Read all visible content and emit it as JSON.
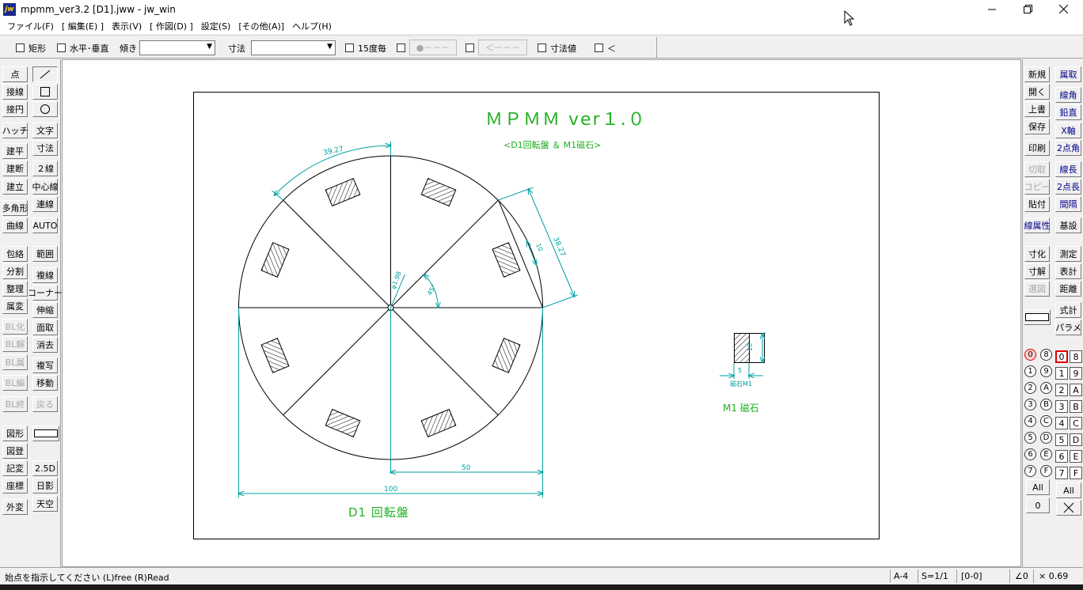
{
  "window": {
    "title": "mpmm_ver3.2 [D1].jww - jw_win",
    "logo_text": "jw",
    "minimize_icon": "minimize-icon",
    "restore_icon": "restore-icon",
    "close_icon": "close-icon"
  },
  "menu": [
    "ファイル(F)",
    "[ 編集(E) ]",
    "表示(V)",
    "[ 作図(D) ]",
    "設定(S)",
    "[その他(A)]",
    "ヘルプ(H)"
  ],
  "options": {
    "rect": "矩形",
    "hv": "水平･垂直",
    "tilt": "傾き",
    "tilt_value": "",
    "dim": "寸法",
    "dim_value": "",
    "deg15": "15度毎",
    "btn_a": "●－－－",
    "btn_b": "＜－－－",
    "dimval": "寸法値",
    "lt": "＜"
  },
  "left_tools": {
    "col1": [
      "点",
      "接線",
      "接円",
      "ハッチ",
      "建平",
      "建断",
      "建立",
      "多角形",
      "曲線",
      "包絡",
      "分割",
      "整理",
      "属変",
      "BL化",
      "BL解",
      "BL属",
      "BL編",
      "BL終",
      "図形",
      "図登",
      "記変",
      "座標",
      "外変"
    ],
    "col2": [
      "文字",
      "寸法",
      "２線",
      "中心線",
      "連線",
      "AUTO",
      "範囲",
      "複線",
      "コーナー",
      "伸縮",
      "面取",
      "消去",
      "複写",
      "移動",
      "戻る",
      "2.5D",
      "日影",
      "天空"
    ]
  },
  "right_tools": {
    "col1": [
      "新規",
      "開く",
      "上書",
      "保存",
      "印刷",
      "切取",
      "コピー",
      "貼付",
      "線属性",
      "寸化",
      "寸解",
      "選図"
    ],
    "col2": [
      "属取",
      "線角",
      "鉛直",
      "X軸",
      "2点角",
      "線長",
      "2点長",
      "間隔",
      "基設",
      "測定",
      "表計",
      "距離",
      "式計",
      "パラメ"
    ],
    "layer_groups": [
      "0",
      "1",
      "2",
      "3",
      "4",
      "5",
      "6",
      "7",
      "8",
      "9",
      "A",
      "B",
      "C",
      "D",
      "E",
      "F"
    ],
    "layers": [
      "0",
      "1",
      "2",
      "3",
      "4",
      "5",
      "6",
      "7",
      "8",
      "9",
      "A",
      "B",
      "C",
      "D",
      "E",
      "F"
    ],
    "all_label": "All",
    "zero_label": "0"
  },
  "drawing": {
    "title": "ＭＰＭＭ ver１.０",
    "subtitle": "<D1回転盤 ＆ M1磁石>",
    "d1_label": "D1 回転盤",
    "m1_label": "M1 磁石",
    "magnet_small_label": "磁石M1",
    "dim_100": "100",
    "dim_50": "50",
    "dim_arc": "39.27",
    "dim_chord": "38.27",
    "dim_10_a": "10",
    "dim_10_b": "10",
    "dim_5": "5",
    "dim_phi": "φ1.98",
    "dim_45": "45°"
  },
  "status": {
    "message": "始点を指示してください (L)free (R)Read",
    "paper": "A-4",
    "scale": "S=1/1",
    "layer": "[0-0]",
    "angle": "∠0",
    "zoom": "× 0.69"
  }
}
